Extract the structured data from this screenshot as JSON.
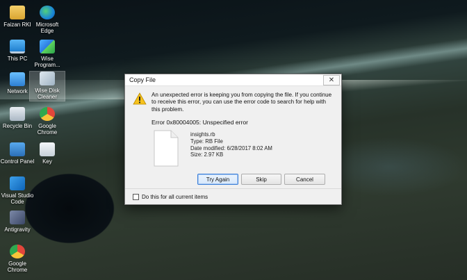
{
  "desktop": {
    "icons": [
      {
        "label": "Faizan RKI"
      },
      {
        "label": "Microsoft Edge"
      },
      {
        "label": "This PC"
      },
      {
        "label": "Wise Program..."
      },
      {
        "label": "Network"
      },
      {
        "label": "Wise Disk Cleaner"
      },
      {
        "label": "Recycle Bin"
      },
      {
        "label": "Google Chrome"
      },
      {
        "label": "Control Panel"
      },
      {
        "label": "Key"
      },
      {
        "label": "Visual Studio Code"
      },
      {
        "label": "Antigravity"
      },
      {
        "label": "Google Chrome"
      }
    ]
  },
  "dialog": {
    "title": "Copy File",
    "close_glyph": "✕",
    "message": "An unexpected error is keeping you from copying the file. If you continue to receive this error, you can use the error code to search for help with this problem.",
    "error_code": "Error 0x80004005: Unspecified error",
    "file": {
      "name": "insights.rb",
      "type": "Type: RB File",
      "date_modified": "Date modified: 6/28/2017 8:02 AM",
      "size": "Size: 2.97 KB"
    },
    "buttons": {
      "try_again": "Try Again",
      "skip": "Skip",
      "cancel": "Cancel"
    },
    "checkbox": {
      "label": "Do this for all current items",
      "checked": false
    }
  },
  "colors": {
    "dialog_bg": "#f0f0f0",
    "warning_yellow": "#f7c21c",
    "primary_button_border": "#3c7fd8"
  }
}
